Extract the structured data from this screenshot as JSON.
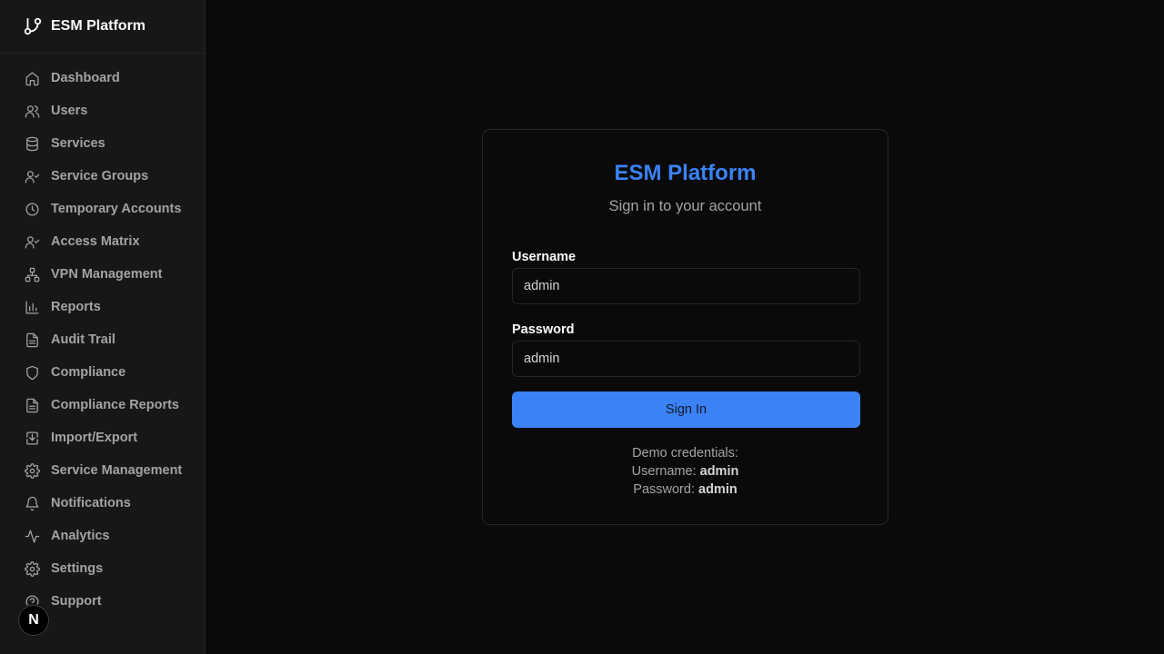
{
  "sidebar": {
    "brand": {
      "title": "ESM Platform",
      "icon": "git-branch-icon"
    },
    "items": [
      {
        "label": "Dashboard",
        "icon": "home-icon"
      },
      {
        "label": "Users",
        "icon": "users-icon"
      },
      {
        "label": "Services",
        "icon": "database-icon"
      },
      {
        "label": "Service Groups",
        "icon": "user-check-icon"
      },
      {
        "label": "Temporary Accounts",
        "icon": "clock-icon"
      },
      {
        "label": "Access Matrix",
        "icon": "user-check-icon"
      },
      {
        "label": "VPN Management",
        "icon": "network-icon"
      },
      {
        "label": "Reports",
        "icon": "bar-chart-icon"
      },
      {
        "label": "Audit Trail",
        "icon": "file-text-icon"
      },
      {
        "label": "Compliance",
        "icon": "shield-icon"
      },
      {
        "label": "Compliance Reports",
        "icon": "file-text-icon"
      },
      {
        "label": "Import/Export",
        "icon": "import-icon"
      },
      {
        "label": "Service Management",
        "icon": "gear-icon"
      },
      {
        "label": "Notifications",
        "icon": "bell-icon"
      },
      {
        "label": "Analytics",
        "icon": "activity-icon"
      },
      {
        "label": "Settings",
        "icon": "gear-icon"
      },
      {
        "label": "Support",
        "icon": "help-circle-icon"
      }
    ]
  },
  "dev_badge": {
    "label": "N"
  },
  "login": {
    "title": "ESM Platform",
    "subtitle": "Sign in to your account",
    "username_label": "Username",
    "username_value": "admin",
    "password_label": "Password",
    "password_value": "admin",
    "submit_label": "Sign In",
    "demo_heading": "Demo credentials:",
    "demo_username_label": "Username:",
    "demo_username_value": "admin",
    "demo_password_label": "Password:",
    "demo_password_value": "admin"
  },
  "colors": {
    "accent": "#3b82f6",
    "background": "#0a0a0a",
    "sidebar": "#171717"
  }
}
